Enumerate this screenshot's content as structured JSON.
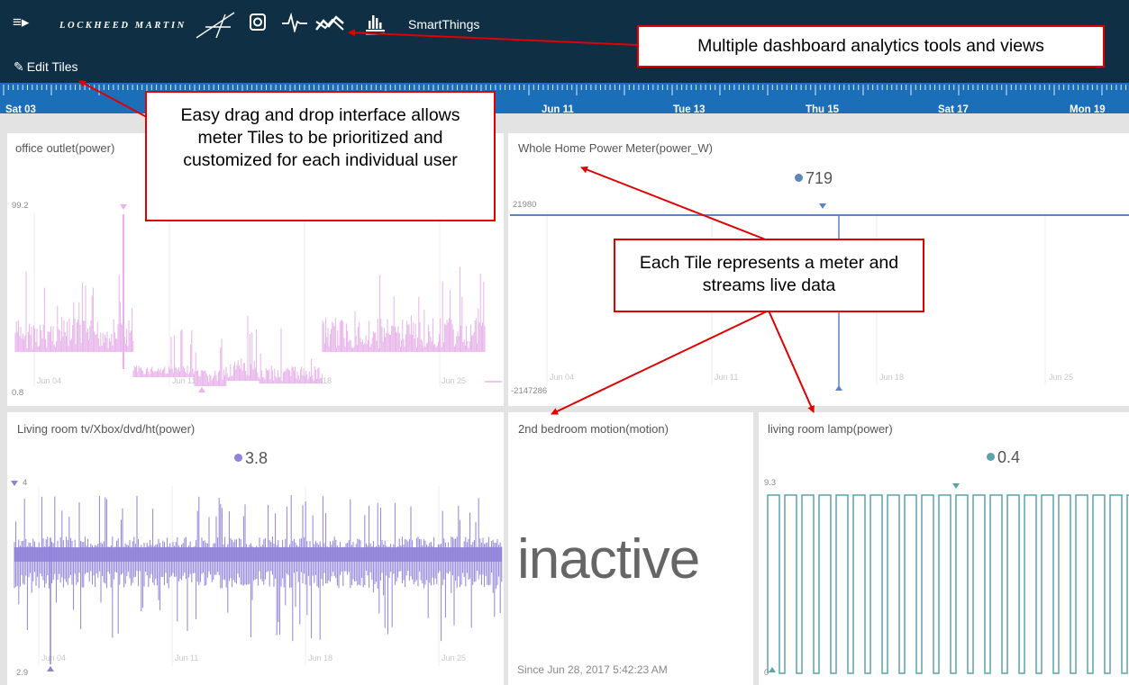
{
  "header": {
    "menu_icon": "hamburger-menu-icon",
    "logo_text": "LOCKHEED MARTIN",
    "app_title": "SmartThings",
    "toolbar_icons": [
      "dashboard-icon",
      "pulse-icon",
      "trend-icon",
      "bar-chart-icon"
    ],
    "edit_tiles_label": "Edit Tiles",
    "colors": {
      "header_bg": "#0f2f45",
      "timeline_bg": "#1b6eb8"
    }
  },
  "timeline": {
    "labels": [
      "Sat 03",
      "Jun 11",
      "Tue 13",
      "Thu 15",
      "Sat 17",
      "Mon 19"
    ]
  },
  "tiles": {
    "office": {
      "title": "office outlet(power)",
      "y_max": "99.2",
      "y_min": "0.8",
      "x_labels": [
        "Jun 04",
        "Jun 11",
        "Jun 18",
        "Jun 25"
      ],
      "color": "#e8b3ea"
    },
    "whole_home": {
      "title": "Whole Home Power Meter(power_W)",
      "value": "719",
      "y_max": "21980",
      "y_min": "-2147286",
      "x_labels": [
        "Jun 04",
        "Jun 11",
        "Jun 18",
        "Jun 25"
      ],
      "color": "#5b86bd"
    },
    "living_tv": {
      "title": "Living room tv/Xbox/dvd/ht(power)",
      "value": "3.8",
      "y_max": "4",
      "y_min": "2.9",
      "x_labels": [
        "Jun 04",
        "Jun 11",
        "Jun 18",
        "Jun 25"
      ],
      "color": "#9083d9"
    },
    "motion": {
      "title": "2nd bedroom motion(motion)",
      "status": "inactive",
      "since": "Since Jun 28, 2017 5:42:23 AM"
    },
    "lamp": {
      "title": "living room lamp(power)",
      "value": "0.4",
      "y_max": "9.3",
      "y_min": "0",
      "color": "#5ba3aa"
    }
  },
  "callouts": {
    "tools": "Multiple dashboard analytics tools and views",
    "drag_drop": "Easy drag and drop interface allows meter Tiles to be prioritized and customized for each individual user",
    "tile_info": "Each Tile represents a meter and streams live data"
  }
}
